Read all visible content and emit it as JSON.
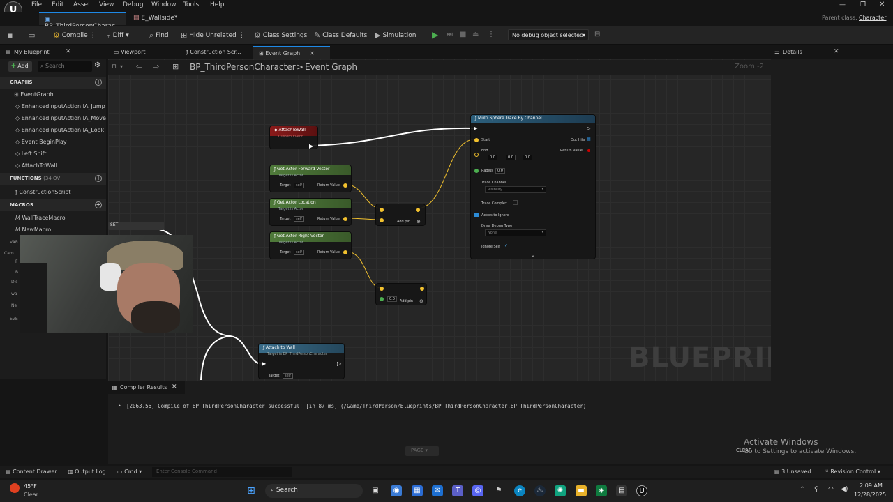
{
  "menu": [
    "File",
    "Edit",
    "Asset",
    "View",
    "Debug",
    "Window",
    "Tools",
    "Help"
  ],
  "window": {
    "parent_class_label": "Parent class:",
    "parent_class_value": "Character"
  },
  "doc_tabs": [
    {
      "label": "BP_ThirdPersonCharac...",
      "modified": "•"
    },
    {
      "label": "E_Wallside*"
    }
  ],
  "toolbar": {
    "compile": "Compile",
    "diff": "Diff",
    "find": "Find",
    "hide_unrelated": "Hide Unrelated",
    "class_settings": "Class Settings",
    "class_defaults": "Class Defaults",
    "simulation": "Simulation",
    "debug_object": "No debug object selected"
  },
  "my_blueprint": {
    "title": "My Blueprint",
    "add": "Add",
    "search_placeholder": "Search",
    "graphs_header": "GRAPHS",
    "graphs": [
      "EventGraph",
      "EnhancedInputAction IA_Jump",
      "EnhancedInputAction IA_Move",
      "EnhancedInputAction IA_Look",
      "Event BeginPlay",
      "Left Shift",
      "AttachToWall"
    ],
    "functions_header": "FUNCTIONS",
    "functions_count": "(34 OV",
    "functions": [
      "ConstructionScript"
    ],
    "macros_header": "MACROS",
    "macros": [
      "WallTraceMacro",
      "NewMacro"
    ],
    "partial_rows": [
      "VAR",
      "Cam",
      "F",
      "B",
      "Dis",
      "wa",
      "Ne",
      "EVE"
    ]
  },
  "graph_tabs": [
    "Viewport",
    "Construction Scr...",
    "Event Graph"
  ],
  "breadcrumb": {
    "root": "BP_ThirdPersonCharacter",
    "separator": ">",
    "current": "Event Graph",
    "zoom": "Zoom -2"
  },
  "watermark": "BLUEPRINT",
  "nodes": {
    "attach_event": {
      "title": "AttachToWall",
      "subtitle": "Custom Event"
    },
    "forward": {
      "title": "Get Actor Forward Vector",
      "subtitle": "Target is Actor",
      "target": "Target",
      "self": "self",
      "return": "Return Value"
    },
    "location": {
      "title": "Get Actor Location",
      "subtitle": "Target is Actor",
      "target": "Target",
      "self": "self",
      "return": "Return Value"
    },
    "right": {
      "title": "Get Actor Right Vector",
      "subtitle": "Target is Actor",
      "target": "Target",
      "self": "self",
      "return": "Return Value"
    },
    "add1": {
      "add_pin": "Add pin"
    },
    "add2": {
      "value": "0.0",
      "add_pin": "Add pin"
    },
    "trace": {
      "title": "Multi Sphere Trace By Channel",
      "start": "Start",
      "end": "End",
      "end_x": "0.0",
      "end_y": "0.0",
      "end_z": "0.0",
      "radius": "Radius",
      "radius_value": "0.0",
      "trace_channel": "Trace Channel",
      "trace_channel_value": "Visibility",
      "trace_complex": "Trace Complex",
      "actors_to_ignore": "Actors to Ignore",
      "draw_debug_type": "Draw Debug Type",
      "draw_debug_value": "None",
      "ignore_self": "Ignore Self",
      "out_hits": "Out Hits",
      "return_value": "Return Value"
    },
    "attach_call": {
      "title": "Attach to Wall",
      "subtitle": "Target is BP_ThirdPersonCharacter",
      "target": "Target",
      "self": "self"
    },
    "set_label": "SET"
  },
  "details": {
    "title": "Details"
  },
  "compiler": {
    "title": "Compiler Results",
    "message": "[2063.56] Compile of BP_ThirdPersonCharacter successful! [in 87 ms] (/Game/ThirdPerson/Blueprints/BP_ThirdPersonCharacter.BP_ThirdPersonCharacter)",
    "page": "PAGE",
    "clear": "CLEAR"
  },
  "activate": {
    "title": "Activate Windows",
    "subtitle": "Go to Settings to activate Windows."
  },
  "statusbar": {
    "content_drawer": "Content Drawer",
    "output_log": "Output Log",
    "cmd": "Cmd",
    "console_placeholder": "Enter Console Command",
    "unsaved": "3 Unsaved",
    "revision": "Revision Control"
  },
  "taskbar": {
    "weather_temp": "45°F",
    "weather_desc": "Clear",
    "search": "Search",
    "time": "2:09 AM",
    "date": "12/28/2025"
  },
  "colors": {
    "accent": "#1e88e5",
    "event_red": "#8b1a1a",
    "pure_green": "#4f7a3a",
    "trace_blue": "#2c5f7c",
    "pin_yellow": "#f2c12e"
  }
}
